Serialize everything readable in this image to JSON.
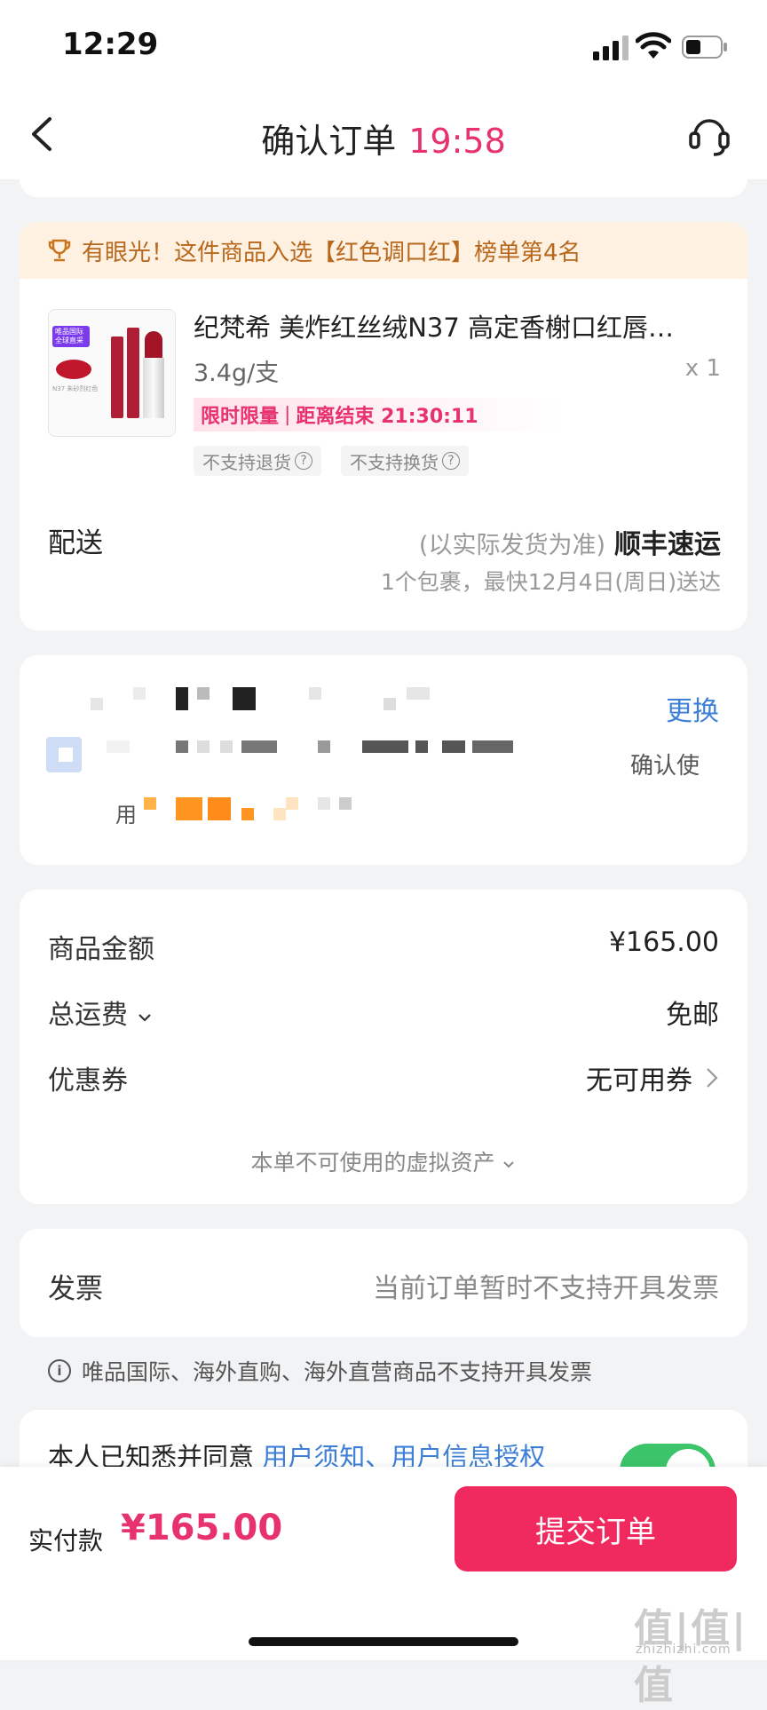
{
  "status_bar": {
    "time": "12:29"
  },
  "nav": {
    "title": "确认订单",
    "countdown": "19:58"
  },
  "product": {
    "banner": "有眼光！这件商品入选【红色调口红】榜单第4名",
    "name": "纪梵希 美炸红丝绒N37 高定香榭口红唇…",
    "spec": "3.4g/支",
    "qty": "x 1",
    "promo_label": "限时限量",
    "promo_sep": "|",
    "promo_countdown": "距离结束 21:30:11",
    "tags": [
      "不支持退货",
      "不支持换货"
    ],
    "thumb_badge": "唯品国际 全球直采",
    "thumb_caption": "N37 朱砂烈红色"
  },
  "shipping": {
    "label": "配送",
    "note": "(以实际发货为准)",
    "carrier": "顺丰速运",
    "eta": "1个包裹，最快12月4日(周日)送达"
  },
  "address": {
    "change": "更换",
    "confirm_text": "确认使",
    "use_text": "用"
  },
  "price": {
    "rows": [
      {
        "label": "商品金额",
        "value": "¥165.00"
      },
      {
        "label": "总运费",
        "value": "免邮"
      },
      {
        "label": "优惠券",
        "value": "无可用券"
      }
    ],
    "virtual_assets": "本单不可使用的虚拟资产"
  },
  "invoice": {
    "label": "发票",
    "value": "当前订单暂时不支持开具发票",
    "note": "唯品国际、海外直购、海外直营商品不支持开具发票"
  },
  "agreement": {
    "prefix": "本人已知悉并同意 ",
    "links": "用户须知、用户信息授权",
    "checked": true
  },
  "bottom": {
    "pay_label": "实付款",
    "pay_amount": "¥165.00",
    "submit": "提交订单"
  },
  "watermark": {
    "logo": "值|值|值",
    "site": "zhizhizhi.com"
  },
  "colors": {
    "accent": "#e8316f",
    "link": "#3d7fd6",
    "toggle": "#3cc46a",
    "banner_bg": "#fff1e2"
  }
}
